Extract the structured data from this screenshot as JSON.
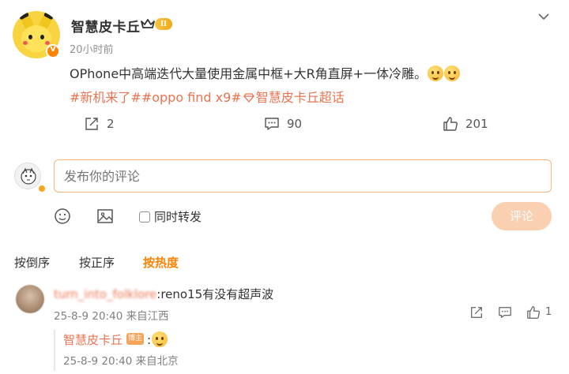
{
  "post": {
    "username": "智慧皮卡丘",
    "level_badge": "II",
    "time": "20小时前",
    "text": "OPhone中高端迭代大量使用金属中框+大R角直屏+一体冷雕。",
    "emojis": [
      "grin-emoji",
      "grin-emoji"
    ],
    "tags": "#新机来了##oppo find x9#",
    "super_topic": "智慧皮卡丘超话",
    "accent_color": "#ff8200",
    "link_color": "#eb7350"
  },
  "actions": {
    "repost_count": "2",
    "comment_count": "90",
    "like_count": "201"
  },
  "composer": {
    "placeholder": "发布你的评论",
    "repost_label": "同时转发",
    "submit_label": "评论"
  },
  "sort": {
    "oldest": "按倒序",
    "newest": "按正序",
    "hot": "按热度"
  },
  "comments": [
    {
      "author": "turn_into_folklore",
      "text": ":reno15有没有超声波",
      "time": "25-8-9 20:40",
      "location": "来自江西",
      "like_count": "1",
      "reply": {
        "author": "智慧皮卡丘",
        "badge": "博主",
        "text": ":",
        "time": "25-8-9 20:40",
        "location": "来自北京"
      }
    }
  ]
}
